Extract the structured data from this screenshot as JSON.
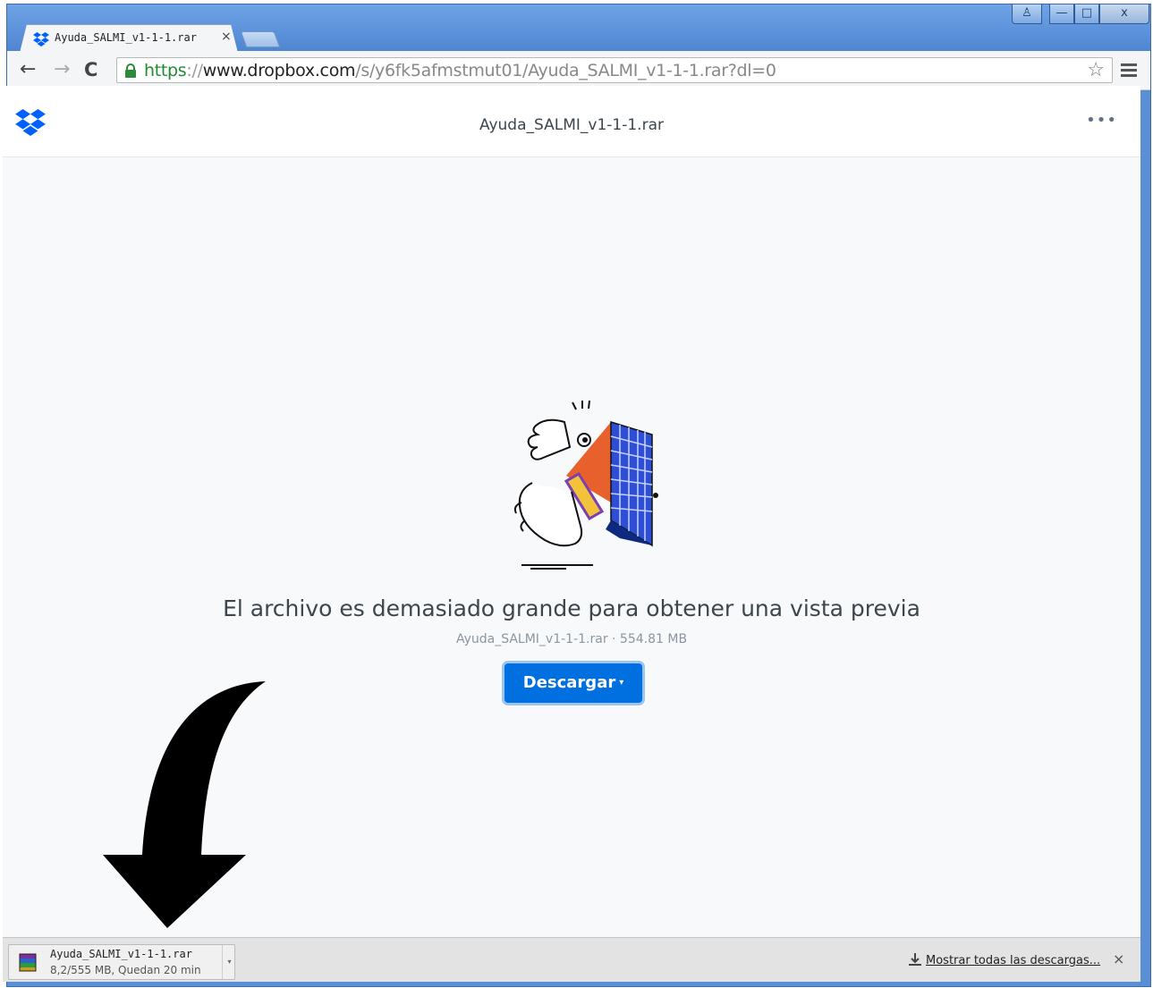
{
  "browser": {
    "tab": {
      "title": "Ayuda_SALMI_v1-1-1.rar",
      "close_glyph": "×"
    },
    "window_controls": {
      "user": "♙",
      "minimize": "—",
      "maximize": "□",
      "close": "x"
    },
    "address": {
      "scheme": "https",
      "separator": "://",
      "host": "www.dropbox.com",
      "path": "/s/y6fk5afmstmut01/Ayuda_SALMI_v1-1-1.rar?dl=0"
    },
    "nav": {
      "back": "←",
      "forward": "→",
      "reload": "C",
      "star": "☆"
    }
  },
  "page": {
    "header": {
      "title": "Ayuda_SALMI_v1-1-1.rar",
      "more": "•••"
    },
    "message": "El archivo es demasiado grande para obtener una vista previa",
    "file_info": "Ayuda_SALMI_v1-1-1.rar · 554.81 MB",
    "download_button": {
      "label": "Descargar",
      "caret": "▾"
    }
  },
  "download_shelf": {
    "item": {
      "filename": "Ayuda_SALMI_v1-1-1.rar",
      "status": "8,2/555 MB, Quedan 20 min"
    },
    "show_all": "Mostrar todas las descargas...",
    "close": "×"
  },
  "colors": {
    "primary_button": "#0070e0",
    "dropbox_blue": "#0061fe",
    "url_scheme_green": "#1e8b32"
  }
}
